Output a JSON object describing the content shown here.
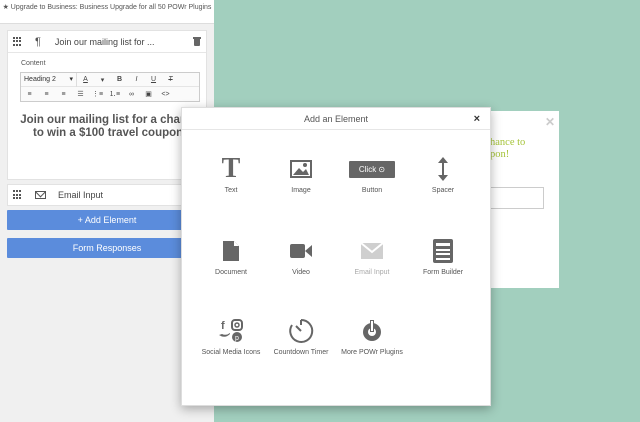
{
  "upgrade_bar": {
    "text": "Upgrade to Business: Business Upgrade for all 50 POWr Plugins"
  },
  "mailing_card": {
    "title": "Join our mailing list for ...",
    "content_label": "Content",
    "heading_select": "Heading 2",
    "editor_text": "Join our mailing list for a chance to win a $100 travel coupon!",
    "toolbar_glyphs": {
      "bold": "B",
      "italic": "I",
      "underline": "U",
      "font_color": "A"
    }
  },
  "email_card": {
    "title": "Email Input"
  },
  "buttons": {
    "add_element": "+ Add Element",
    "form_responses": "Form Responses"
  },
  "preview": {
    "text": "hance to win a $100 travel coupon!",
    "text_line1": "hance to",
    "text_line2": "pon!",
    "accent_color": "#a6c43a"
  },
  "modal": {
    "title": "Add an Element",
    "close": "×",
    "tiles": [
      {
        "label": "Text",
        "icon": "text-icon"
      },
      {
        "label": "Image",
        "icon": "image-icon"
      },
      {
        "label": "Button",
        "icon": "button-icon",
        "button_text": "Click"
      },
      {
        "label": "Spacer",
        "icon": "spacer-icon"
      },
      {
        "label": "Document",
        "icon": "document-icon"
      },
      {
        "label": "Video",
        "icon": "video-icon"
      },
      {
        "label": "Email Input",
        "icon": "email-icon",
        "disabled": true
      },
      {
        "label": "Form Builder",
        "icon": "form-builder-icon"
      },
      {
        "label": "Social Media Icons",
        "icon": "social-media-icon"
      },
      {
        "label": "Countdown Timer",
        "icon": "countdown-timer-icon"
      },
      {
        "label": "More POWr Plugins",
        "icon": "powr-plugins-icon"
      }
    ]
  },
  "colors": {
    "background": "#a2cfbe",
    "primary_button": "#5b8cdc",
    "icon": "#666666"
  }
}
